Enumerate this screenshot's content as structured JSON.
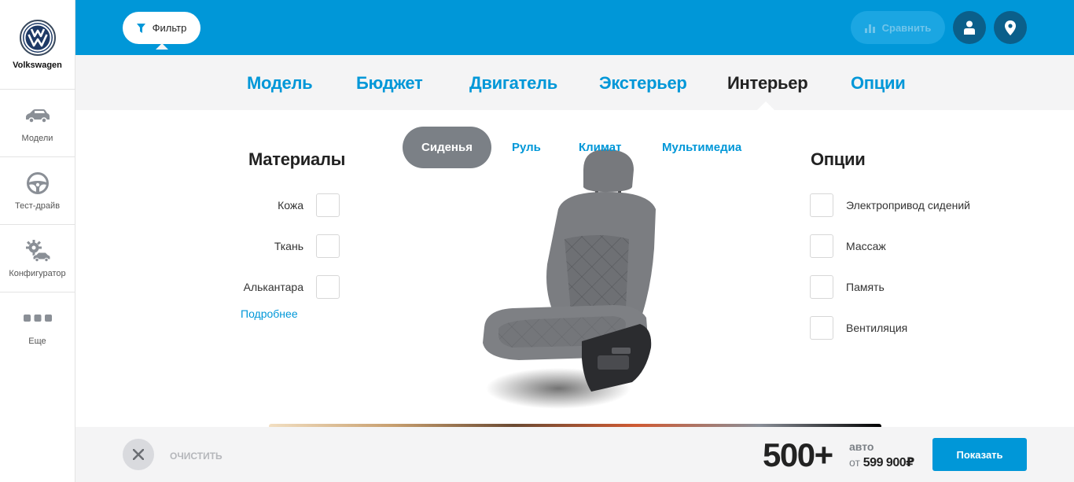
{
  "brand": {
    "name": "Volkswagen",
    "icon": "vw-logo-icon"
  },
  "sidebar": {
    "items": [
      {
        "label": "Модели",
        "icon": "car-icon"
      },
      {
        "label": "Тест-драйв",
        "icon": "steering-wheel-icon"
      },
      {
        "label": "Конфигуратор",
        "icon": "gear-car-icon"
      },
      {
        "label": "Еще",
        "icon": "more-dots-icon"
      }
    ]
  },
  "topbar": {
    "filter_label": "Фильтр",
    "compare_label": "Сравнить",
    "user_icon": "user-icon",
    "location_icon": "location-pin-icon"
  },
  "categories": {
    "tabs": [
      {
        "label": "Модель"
      },
      {
        "label": "Бюджет"
      },
      {
        "label": "Двигатель"
      },
      {
        "label": "Экстерьер"
      },
      {
        "label": "Интерьер",
        "active": true
      },
      {
        "label": "Опции"
      }
    ]
  },
  "subtabs": {
    "items": [
      {
        "label": "Сиденья",
        "active": true
      },
      {
        "label": "Руль"
      },
      {
        "label": "Климат"
      },
      {
        "label": "Мультимедиа"
      }
    ]
  },
  "materials": {
    "title": "Материалы",
    "items": [
      {
        "label": "Кожа",
        "checked": false
      },
      {
        "label": "Ткань",
        "checked": false
      },
      {
        "label": "Алькантара",
        "checked": false
      }
    ],
    "more_link": "Подробнее"
  },
  "options": {
    "title": "Опции",
    "items": [
      {
        "label": "Электропривод сидений",
        "checked": false
      },
      {
        "label": "Массаж",
        "checked": false
      },
      {
        "label": "Память",
        "checked": false
      },
      {
        "label": "Вентиляция",
        "checked": false
      }
    ]
  },
  "bottom": {
    "clear_label": "ОЧИСТИТЬ",
    "count": "500+",
    "count_unit": "авто",
    "price_prefix": "от",
    "price": "599 900₽",
    "show_label": "Показать"
  },
  "colors": {
    "accent": "#0097d8",
    "pill": "#7b8086",
    "panel": "#f4f4f5",
    "dark_round": "#0b5f8a"
  }
}
